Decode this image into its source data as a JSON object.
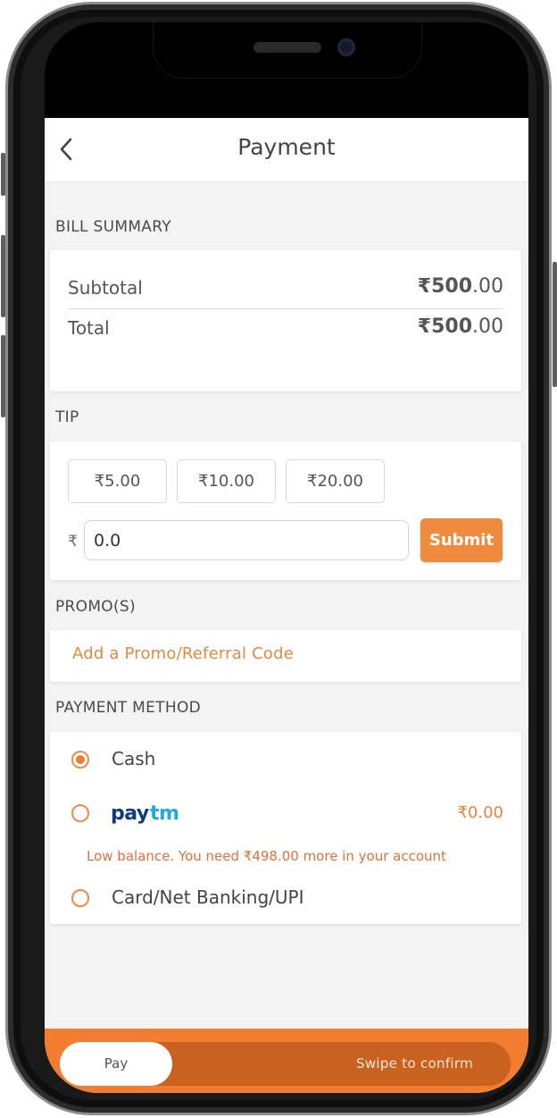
{
  "header": {
    "title": "Payment"
  },
  "bill_summary": {
    "section_label": "BILL SUMMARY",
    "subtotal_label": "Subtotal",
    "subtotal_whole": "₹500",
    "subtotal_decimals": ".00",
    "total_label": "Total",
    "total_whole": "₹500",
    "total_decimals": ".00"
  },
  "tip": {
    "section_label": "TIP",
    "chips": [
      "₹5.00",
      "₹10.00",
      "₹20.00"
    ],
    "currency_symbol": "₹",
    "input_value": "0.0",
    "submit_label": "Submit"
  },
  "promo": {
    "section_label": "PROMO(S)",
    "link_label": "Add a Promo/Referral Code"
  },
  "payment_method": {
    "section_label": "PAYMENT METHOD",
    "options": [
      {
        "label": "Cash",
        "selected": true
      },
      {
        "label": "Paytm",
        "selected": false,
        "balance": "₹0.00",
        "note": "Low balance. You need ₹498.00 more in your account"
      },
      {
        "label": "Card/Net Banking/UPI",
        "selected": false
      }
    ]
  },
  "footer": {
    "thumb_label": "Pay",
    "hint": "Swipe to confirm"
  },
  "colors": {
    "accent": "#f08a3c",
    "footer": "#f27c2f",
    "paytm_dark": "#0f3b7a",
    "paytm_light": "#1fa9e3"
  }
}
